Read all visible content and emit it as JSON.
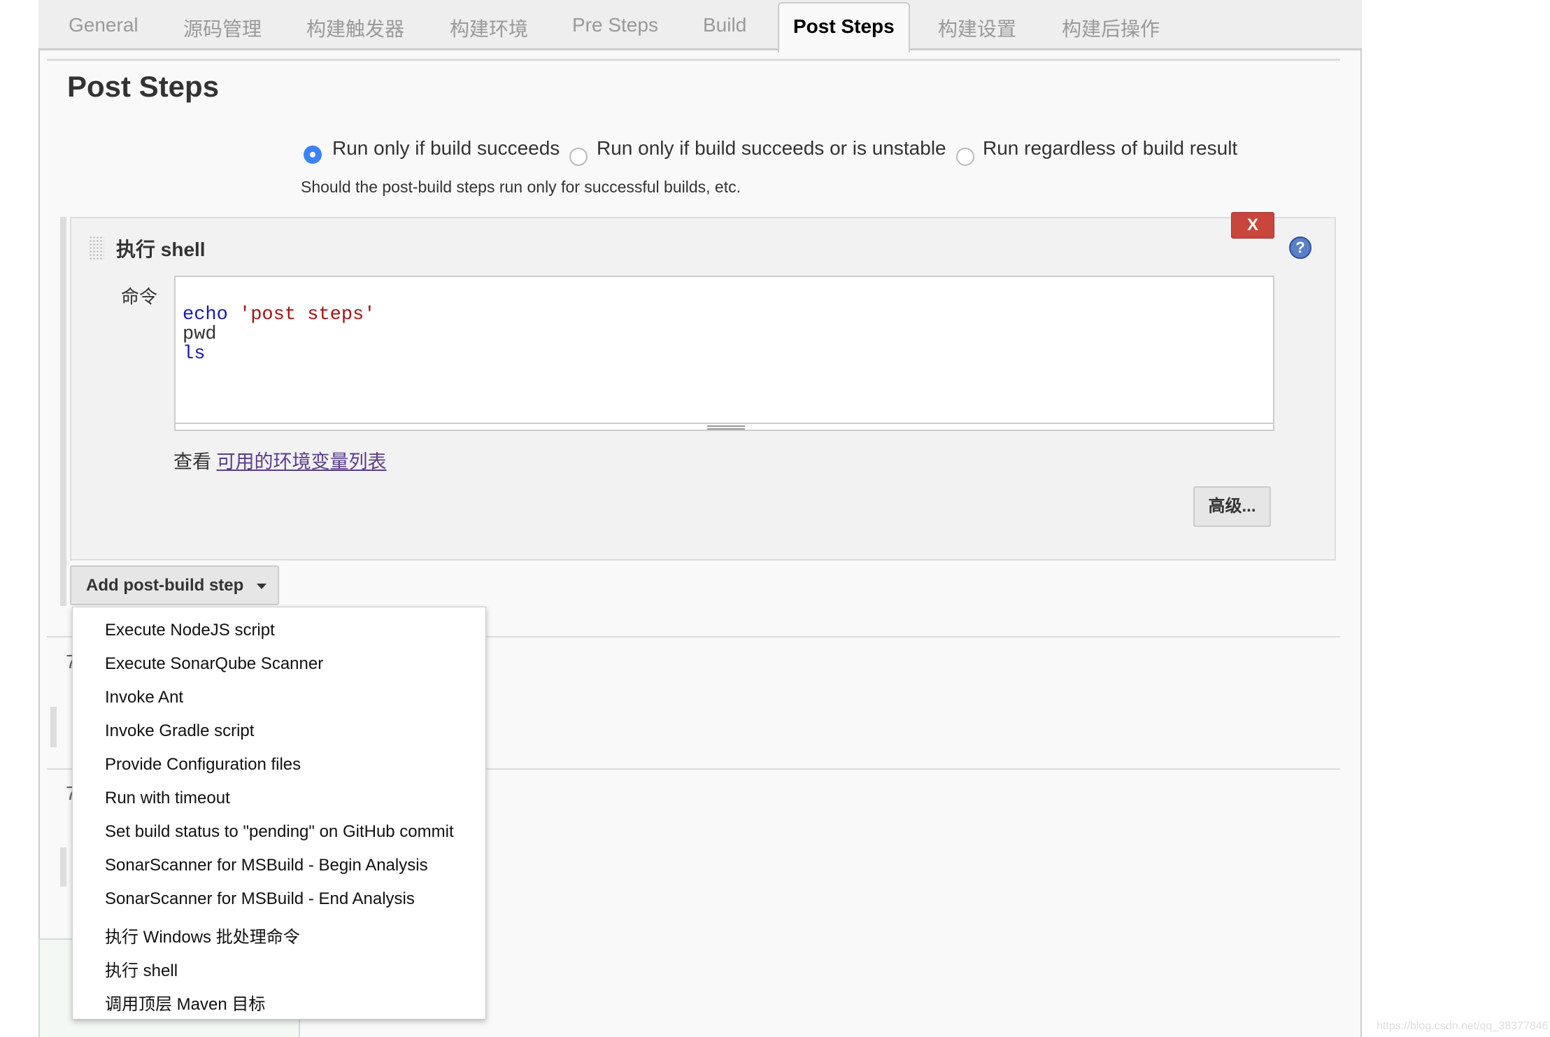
{
  "tabs": [
    "General",
    "源码管理",
    "构建触发器",
    "构建环境",
    "Pre Steps",
    "Build",
    "Post Steps",
    "构建设置",
    "构建后操作"
  ],
  "active_tab": "Post Steps",
  "section_title": "Post Steps",
  "radios": [
    {
      "label": "Run only if build succeeds",
      "checked": true
    },
    {
      "label": "Run only if build succeeds or is unstable",
      "checked": false
    },
    {
      "label": "Run regardless of build result",
      "checked": false
    }
  ],
  "radio_description": "Should the post-build steps run only for successful builds, etc.",
  "shell_step": {
    "title": "执行 shell",
    "delete_label": "X",
    "help_label": "?",
    "command_label": "命令",
    "command_lines": [
      [
        "echo",
        " 'post steps'"
      ],
      [
        "pwd"
      ],
      [
        "ls"
      ]
    ],
    "env_prefix": "查看 ",
    "env_link": "可用的环境变量列表",
    "advanced_label": "高级..."
  },
  "add_step_button": "Add post-build step",
  "menu_items": [
    "Execute NodeJS script",
    "Execute SonarQube Scanner",
    "Invoke Ant",
    "Invoke Gradle script",
    "Provide Configuration files",
    "Run with timeout",
    "Set build status to \"pending\" on GitHub commit",
    "SonarScanner for MSBuild - Begin Analysis",
    "SonarScanner for MSBuild - End Analysis",
    "执行 Windows 批处理命令",
    "执行 shell",
    "调用顶层 Maven 目标"
  ],
  "watermark": "https://blog.csdn.net/qq_38377846",
  "colors": {
    "delete": "#c9463d",
    "radio_checked": "#3b82f6",
    "link": "#5a3d8a"
  }
}
